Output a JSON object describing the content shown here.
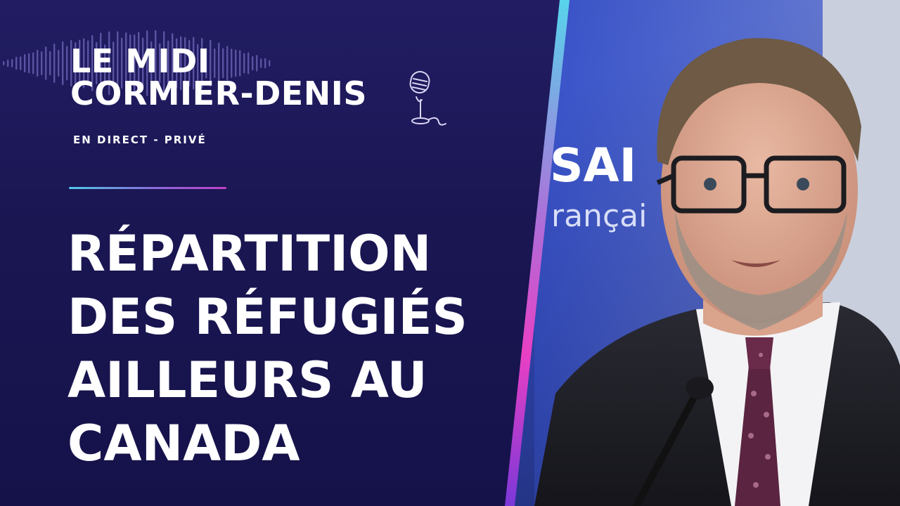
{
  "show": {
    "title_line1": "LE MIDI",
    "title_line2": "CORMIER-DENIS",
    "subtitle": "EN DIRECT - PRIVÉ"
  },
  "headline": {
    "line1": "RÉPARTITION",
    "line2": "DES RÉFUGIÉS",
    "line3": "AILLEURS AU",
    "line4": "CANADA"
  },
  "backdrop": {
    "partial_sign_line1": "SAI",
    "partial_sign_line2": "rançai"
  },
  "colors": {
    "panel_background": "#1b1650",
    "accent_cyan": "#4fc9e6",
    "accent_magenta": "#e040c8",
    "text": "#ffffff"
  }
}
